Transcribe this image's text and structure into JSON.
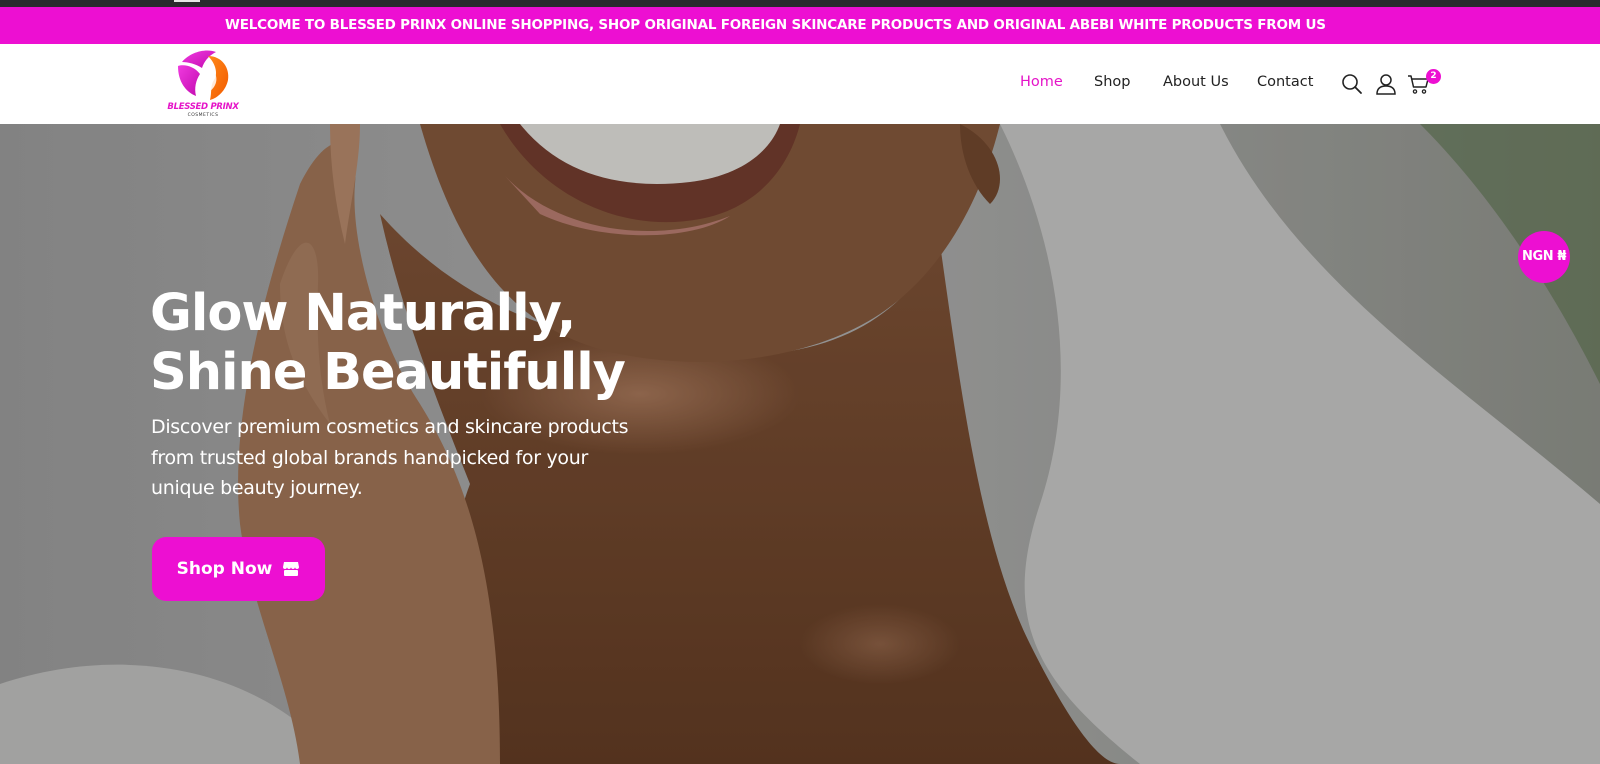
{
  "announcement": "WELCOME TO BLESSED PRINX ONLINE SHOPPING, SHOP ORIGINAL FOREIGN SKINCARE PRODUCTS AND ORIGINAL ABEBI WHITE PRODUCTS FROM US",
  "brand": {
    "name": "BLESSED PRINX",
    "tagline": "COSMETICS"
  },
  "nav": [
    {
      "label": "Home",
      "active": true
    },
    {
      "label": "Shop",
      "active": false
    },
    {
      "label": "About Us",
      "active": false
    },
    {
      "label": "Contact",
      "active": false
    }
  ],
  "icons": [
    "search-icon",
    "user-icon",
    "cart-icon",
    "store-icon"
  ],
  "cart": {
    "count": "2"
  },
  "hero": {
    "title_line1": "Glow Naturally,",
    "title_line2": "Shine Beautifully",
    "description": "Discover premium cosmetics and skincare products from trusted global brands handpicked for your unique beauty journey.",
    "cta": "Shop Now"
  },
  "currency": "NGN ₦",
  "colors": {
    "accent": "#ed0fd2",
    "nav_text": "#222222",
    "hero_text": "#ffffff"
  }
}
